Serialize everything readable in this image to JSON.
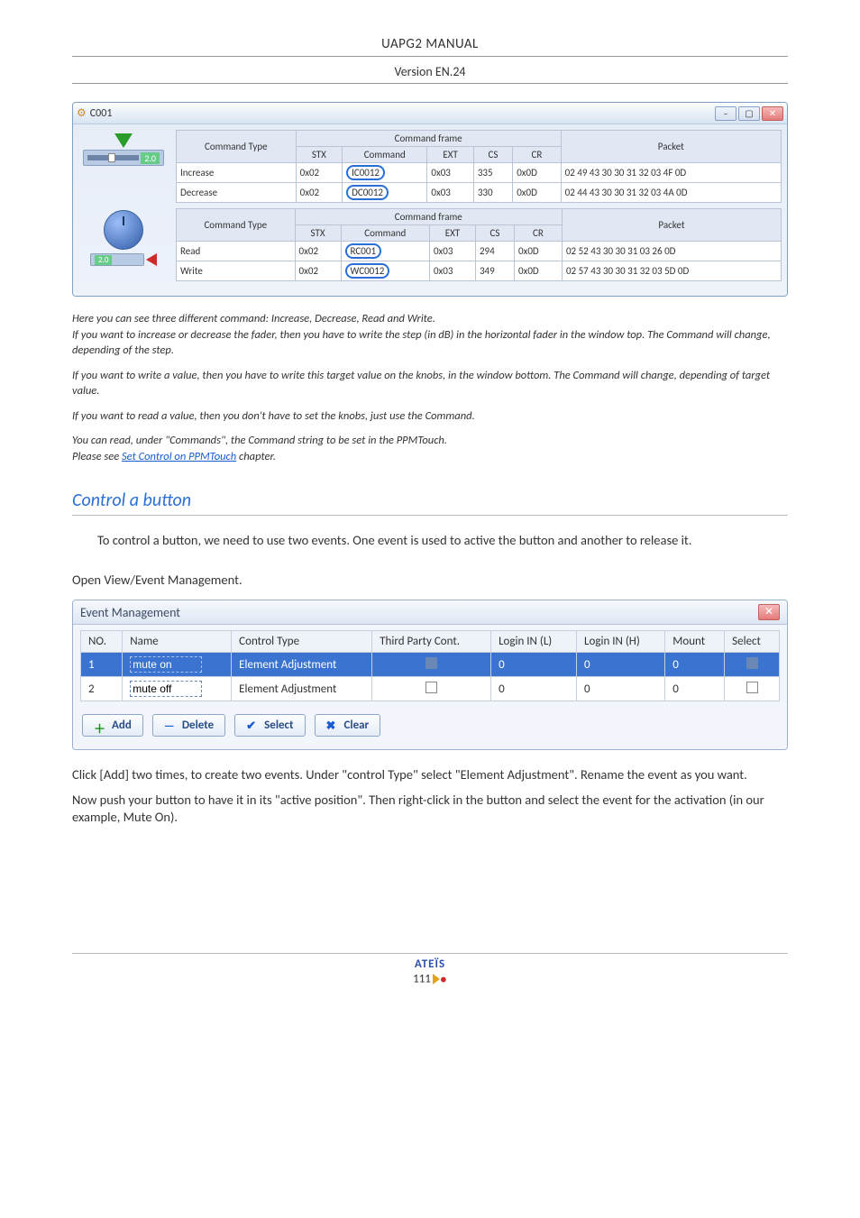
{
  "doc": {
    "title": "UAPG2  MANUAL",
    "version": "Version EN.24",
    "brand": "ATEÏS",
    "page_number": "111"
  },
  "c001": {
    "window_title": "C001",
    "slider_value": "2.0",
    "knob_value": "2.0",
    "group1": {
      "super_header": "Command frame",
      "type_header": "Command Type",
      "packet_header": "Packet",
      "cols": [
        "STX",
        "Command",
        "EXT",
        "CS",
        "CR"
      ],
      "rows": [
        {
          "type": "Increase",
          "stx": "0x02",
          "cmd": "IC0012",
          "ext": "0x03",
          "cs": "335",
          "cr": "0x0D",
          "packet": "02 49 43 30 30 31 32 03 4F 0D"
        },
        {
          "type": "Decrease",
          "stx": "0x02",
          "cmd": "DC0012",
          "ext": "0x03",
          "cs": "330",
          "cr": "0x0D",
          "packet": "02 44 43 30 30 31 32 03 4A 0D"
        }
      ]
    },
    "group2": {
      "super_header": "Command frame",
      "type_header": "Command Type",
      "packet_header": "Packet",
      "cols": [
        "STX",
        "Command",
        "EXT",
        "CS",
        "CR"
      ],
      "rows": [
        {
          "type": "Read",
          "stx": "0x02",
          "cmd": "RC001",
          "ext": "0x03",
          "cs": "294",
          "cr": "0x0D",
          "packet": "02 52 43 30 30 31 03 26 0D"
        },
        {
          "type": "Write",
          "stx": "0x02",
          "cmd": "WC0012",
          "ext": "0x03",
          "cs": "349",
          "cr": "0x0D",
          "packet": "02 57 43 30 30 31 32 03 5D 0D"
        }
      ]
    }
  },
  "captions": {
    "c1": "Here you can see three different command: Increase, Decrease, Read and Write.",
    "c2": "If you want to increase or decrease the fader, then you have to write the step (in dB) in the horizontal fader in the window top. The Command will change, depending of the step.",
    "c3": "If you want to write a value, then you have to write this target value on the knobs, in the window bottom. The Command will change, depending of target value.",
    "c4": "If you want to read a value, then you don't have to set the knobs, just use the Command.",
    "c5a": "You can read, under \"Commands\", the Command string to be set in the PPMTouch.",
    "c5b_prefix": "Please see ",
    "c5b_link": "Set Control on PPMTouch",
    "c5b_suffix": " chapter."
  },
  "section": {
    "title": "Control a button",
    "p1": "To control a button, we need to use two events. One event is used to active the button and another to release it.",
    "p2": "Open View/Event Management.",
    "p3": "Click [Add] two times, to create two events. Under \"control Type\" select \"Element Adjustment\". Rename the event as you want.",
    "p4": "Now push your button to have it in its \"active position\". Then right-click in the button and select the event for the activation (in our example, Mute On)."
  },
  "em": {
    "title": "Event Management",
    "headers": [
      "NO.",
      "Name",
      "Control Type",
      "Third Party Cont.",
      "Login IN (L)",
      "Login IN (H)",
      "Mount",
      "Select"
    ],
    "rows": [
      {
        "no": "1",
        "name": "mute on",
        "ctrl": "Element Adjustment",
        "login_l": "0",
        "login_h": "0",
        "mount": "0",
        "selected": true
      },
      {
        "no": "2",
        "name": "mute off",
        "ctrl": "Element Adjustment",
        "login_l": "0",
        "login_h": "0",
        "mount": "0",
        "selected": false
      }
    ],
    "buttons": {
      "add": "Add",
      "delete": "Delete",
      "select": "Select",
      "clear": "Clear"
    }
  }
}
